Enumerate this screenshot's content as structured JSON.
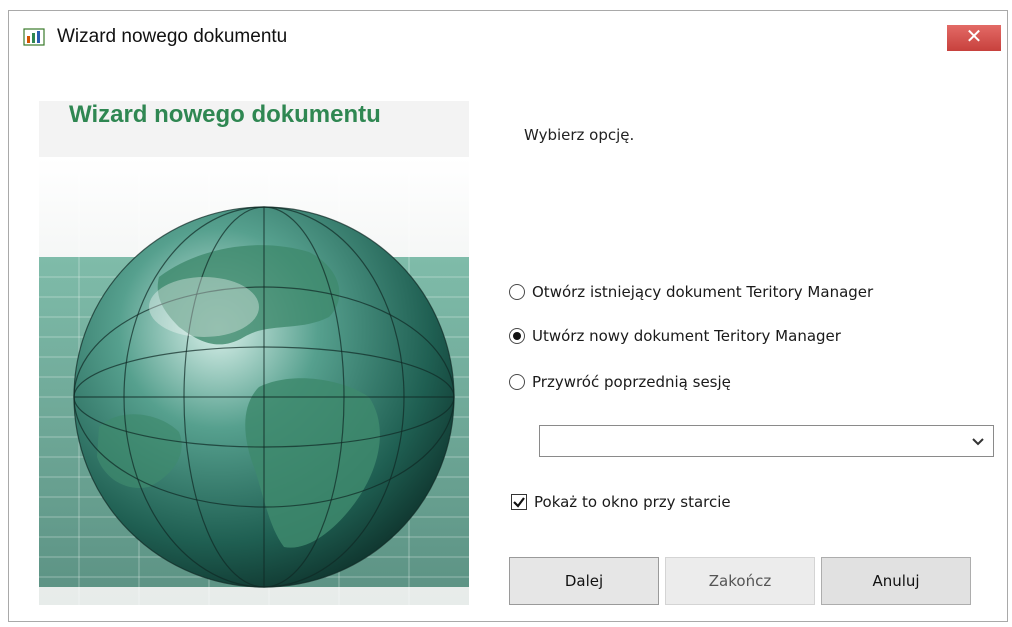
{
  "window": {
    "title": "Wizard nowego dokumentu",
    "close_label": "✕",
    "accent_color": "#2f8752",
    "close_color": "#d9534f"
  },
  "left_panel": {
    "title": "Wizard nowego dokumentu",
    "image": "globe-illustration"
  },
  "main": {
    "instruction": "Wybierz opcję.",
    "options": [
      {
        "label": "Otwórz istniejący dokument Teritory Manager",
        "selected": false
      },
      {
        "label": "Utwórz nowy dokument Teritory Manager",
        "selected": true
      },
      {
        "label": "Przywróć poprzednią sesję",
        "selected": false
      }
    ],
    "session_select": {
      "value": ""
    },
    "show_on_startup": {
      "label": "Pokaż to okno przy starcie",
      "checked": true
    }
  },
  "buttons": {
    "next": "Dalej",
    "finish": "Zakończ",
    "cancel": "Anuluj"
  }
}
